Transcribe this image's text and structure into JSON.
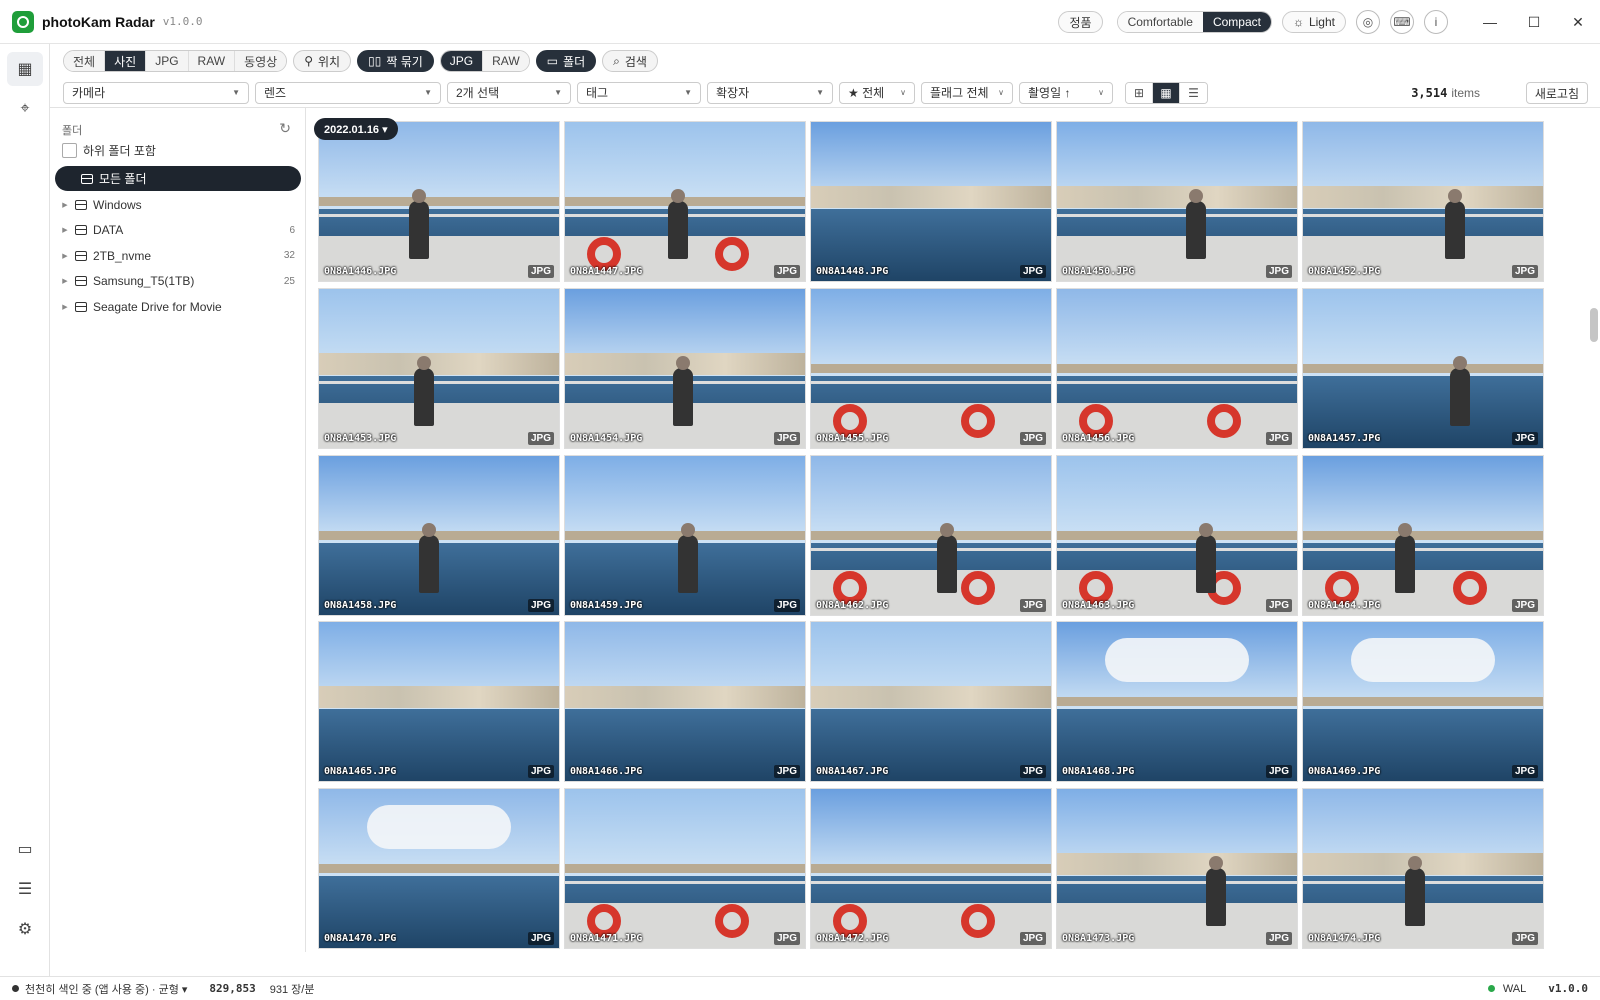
{
  "app": {
    "name": "photoKam Radar",
    "version": "v1.0.0"
  },
  "titlebar": {
    "license": "정품",
    "density": [
      {
        "label": "Comfortable",
        "active": false
      },
      {
        "label": "Compact",
        "active": true
      }
    ],
    "theme_label": "Light",
    "icons": [
      "compass-icon",
      "keyboard-icon",
      "info-icon"
    ],
    "window": {
      "minimize": "—",
      "maximize": "☐",
      "close": "✕"
    }
  },
  "rail": {
    "top": [
      "grid-icon",
      "location-pin-icon"
    ],
    "bottom": [
      "folder-icon",
      "checklist-icon",
      "sliders-icon"
    ]
  },
  "filters": {
    "type_tabs": [
      {
        "label": "전체",
        "active": false
      },
      {
        "label": "사진",
        "active": true
      },
      {
        "label": "JPG",
        "active": false
      },
      {
        "label": "RAW",
        "active": false
      },
      {
        "label": "동영상",
        "active": false
      }
    ],
    "location_label": "위치",
    "pair_label": "짝 묶기",
    "format_tabs": [
      {
        "label": "JPG",
        "active": true
      },
      {
        "label": "RAW",
        "active": false
      }
    ],
    "folder_label": "폴더",
    "search_label": "검색"
  },
  "dropdowns": {
    "camera": "카메라",
    "lens": "렌즈",
    "selection": "2개 선택",
    "tag": "태그",
    "extension": "확장자",
    "rating": "★ 전체",
    "flag": "플래그 전체",
    "sort": "촬영일 ↑"
  },
  "view_modes": [
    "grid-large-icon",
    "grid-compact-icon",
    "list-icon"
  ],
  "items": {
    "count": "3,514",
    "label": "items"
  },
  "refresh_label": "새로고침",
  "folder_panel": {
    "title": "폴더",
    "include_subfolders": "하위 폴더 포함",
    "all_folders": "모든 폴더",
    "folders": [
      {
        "name": "Windows",
        "count": ""
      },
      {
        "name": "DATA",
        "count": "6"
      },
      {
        "name": "2TB_nvme",
        "count": "32"
      },
      {
        "name": "Samsung_T5(1TB)",
        "count": "25"
      },
      {
        "name": "Seagate Drive for Movie",
        "count": ""
      }
    ]
  },
  "date_chip": "2022.01.16 ▾",
  "photos": [
    {
      "name": "0N8A1446.JPG",
      "ext": "JPG",
      "scene": "deck-person"
    },
    {
      "name": "0N8A1447.JPG",
      "ext": "JPG",
      "scene": "rings-person"
    },
    {
      "name": "0N8A1448.JPG",
      "ext": "JPG",
      "scene": "harbor"
    },
    {
      "name": "0N8A1450.JPG",
      "ext": "JPG",
      "scene": "town-person"
    },
    {
      "name": "0N8A1452.JPG",
      "ext": "JPG",
      "scene": "town-person"
    },
    {
      "name": "0N8A1453.JPG",
      "ext": "JPG",
      "scene": "town-person"
    },
    {
      "name": "0N8A1454.JPG",
      "ext": "JPG",
      "scene": "town-person"
    },
    {
      "name": "0N8A1455.JPG",
      "ext": "JPG",
      "scene": "rings"
    },
    {
      "name": "0N8A1456.JPG",
      "ext": "JPG",
      "scene": "rings"
    },
    {
      "name": "0N8A1457.JPG",
      "ext": "JPG",
      "scene": "sea-person"
    },
    {
      "name": "0N8A1458.JPG",
      "ext": "JPG",
      "scene": "sea-person"
    },
    {
      "name": "0N8A1459.JPG",
      "ext": "JPG",
      "scene": "sea-person"
    },
    {
      "name": "0N8A1462.JPG",
      "ext": "JPG",
      "scene": "rings-person"
    },
    {
      "name": "0N8A1463.JPG",
      "ext": "JPG",
      "scene": "rings-person"
    },
    {
      "name": "0N8A1464.JPG",
      "ext": "JPG",
      "scene": "rings-person"
    },
    {
      "name": "0N8A1465.JPG",
      "ext": "JPG",
      "scene": "harbor"
    },
    {
      "name": "0N8A1466.JPG",
      "ext": "JPG",
      "scene": "harbor"
    },
    {
      "name": "0N8A1467.JPG",
      "ext": "JPG",
      "scene": "harbor"
    },
    {
      "name": "0N8A1468.JPG",
      "ext": "JPG",
      "scene": "clouds"
    },
    {
      "name": "0N8A1469.JPG",
      "ext": "JPG",
      "scene": "clouds"
    },
    {
      "name": "0N8A1470.JPG",
      "ext": "JPG",
      "scene": "clouds"
    },
    {
      "name": "0N8A1471.JPG",
      "ext": "JPG",
      "scene": "rings"
    },
    {
      "name": "0N8A1472.JPG",
      "ext": "JPG",
      "scene": "rings"
    },
    {
      "name": "0N8A1473.JPG",
      "ext": "JPG",
      "scene": "town-person"
    },
    {
      "name": "0N8A1474.JPG",
      "ext": "JPG",
      "scene": "town-person"
    }
  ],
  "status": {
    "indexing": "천천히 색인 중 (앱 사용 중) · 균형 ▾",
    "count": "829,853",
    "rate": "931 장/분",
    "mode": "WAL",
    "version": "v1.0.0"
  },
  "colors": {
    "accent_dark": "#27303b",
    "logo_green": "#1f9e3a",
    "ring_red": "#d6362b"
  }
}
